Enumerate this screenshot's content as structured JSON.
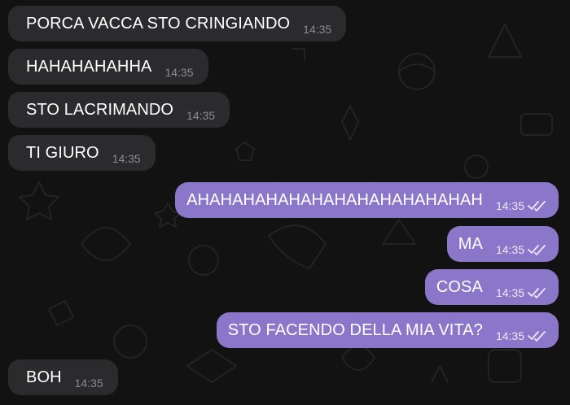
{
  "messages": [
    {
      "dir": "in",
      "text": "PORCA VACCA STO CRINGIANDO",
      "time": "14:35"
    },
    {
      "dir": "in",
      "text": "HAHAHAHAHHA",
      "time": "14:35"
    },
    {
      "dir": "in",
      "text": "STO LACRIMANDO",
      "time": "14:35"
    },
    {
      "dir": "in",
      "text": "TI GIURO",
      "time": "14:35"
    },
    {
      "dir": "out",
      "text": "AHAHAHAHAHAHAHAHAHAHAHAHAH",
      "time": "14:35",
      "status": "read"
    },
    {
      "dir": "out",
      "text": "MA",
      "time": "14:35",
      "status": "read"
    },
    {
      "dir": "out",
      "text": "COSA",
      "time": "14:35",
      "status": "read"
    },
    {
      "dir": "out",
      "text": "STO FACENDO DELLA MIA VITA?",
      "time": "14:35",
      "status": "read"
    },
    {
      "dir": "in",
      "text": "BOH",
      "time": "14:35"
    }
  ],
  "colors": {
    "background": "#121212",
    "incoming_bubble": "#2b2b2d",
    "outgoing_bubble": "#8b77c9",
    "text": "#ffffff",
    "incoming_meta": "#8c8c8e",
    "outgoing_meta": "#ece8f8"
  },
  "icons": {
    "read_status": "double-check-icon",
    "wallpaper": "doodle-pattern"
  }
}
